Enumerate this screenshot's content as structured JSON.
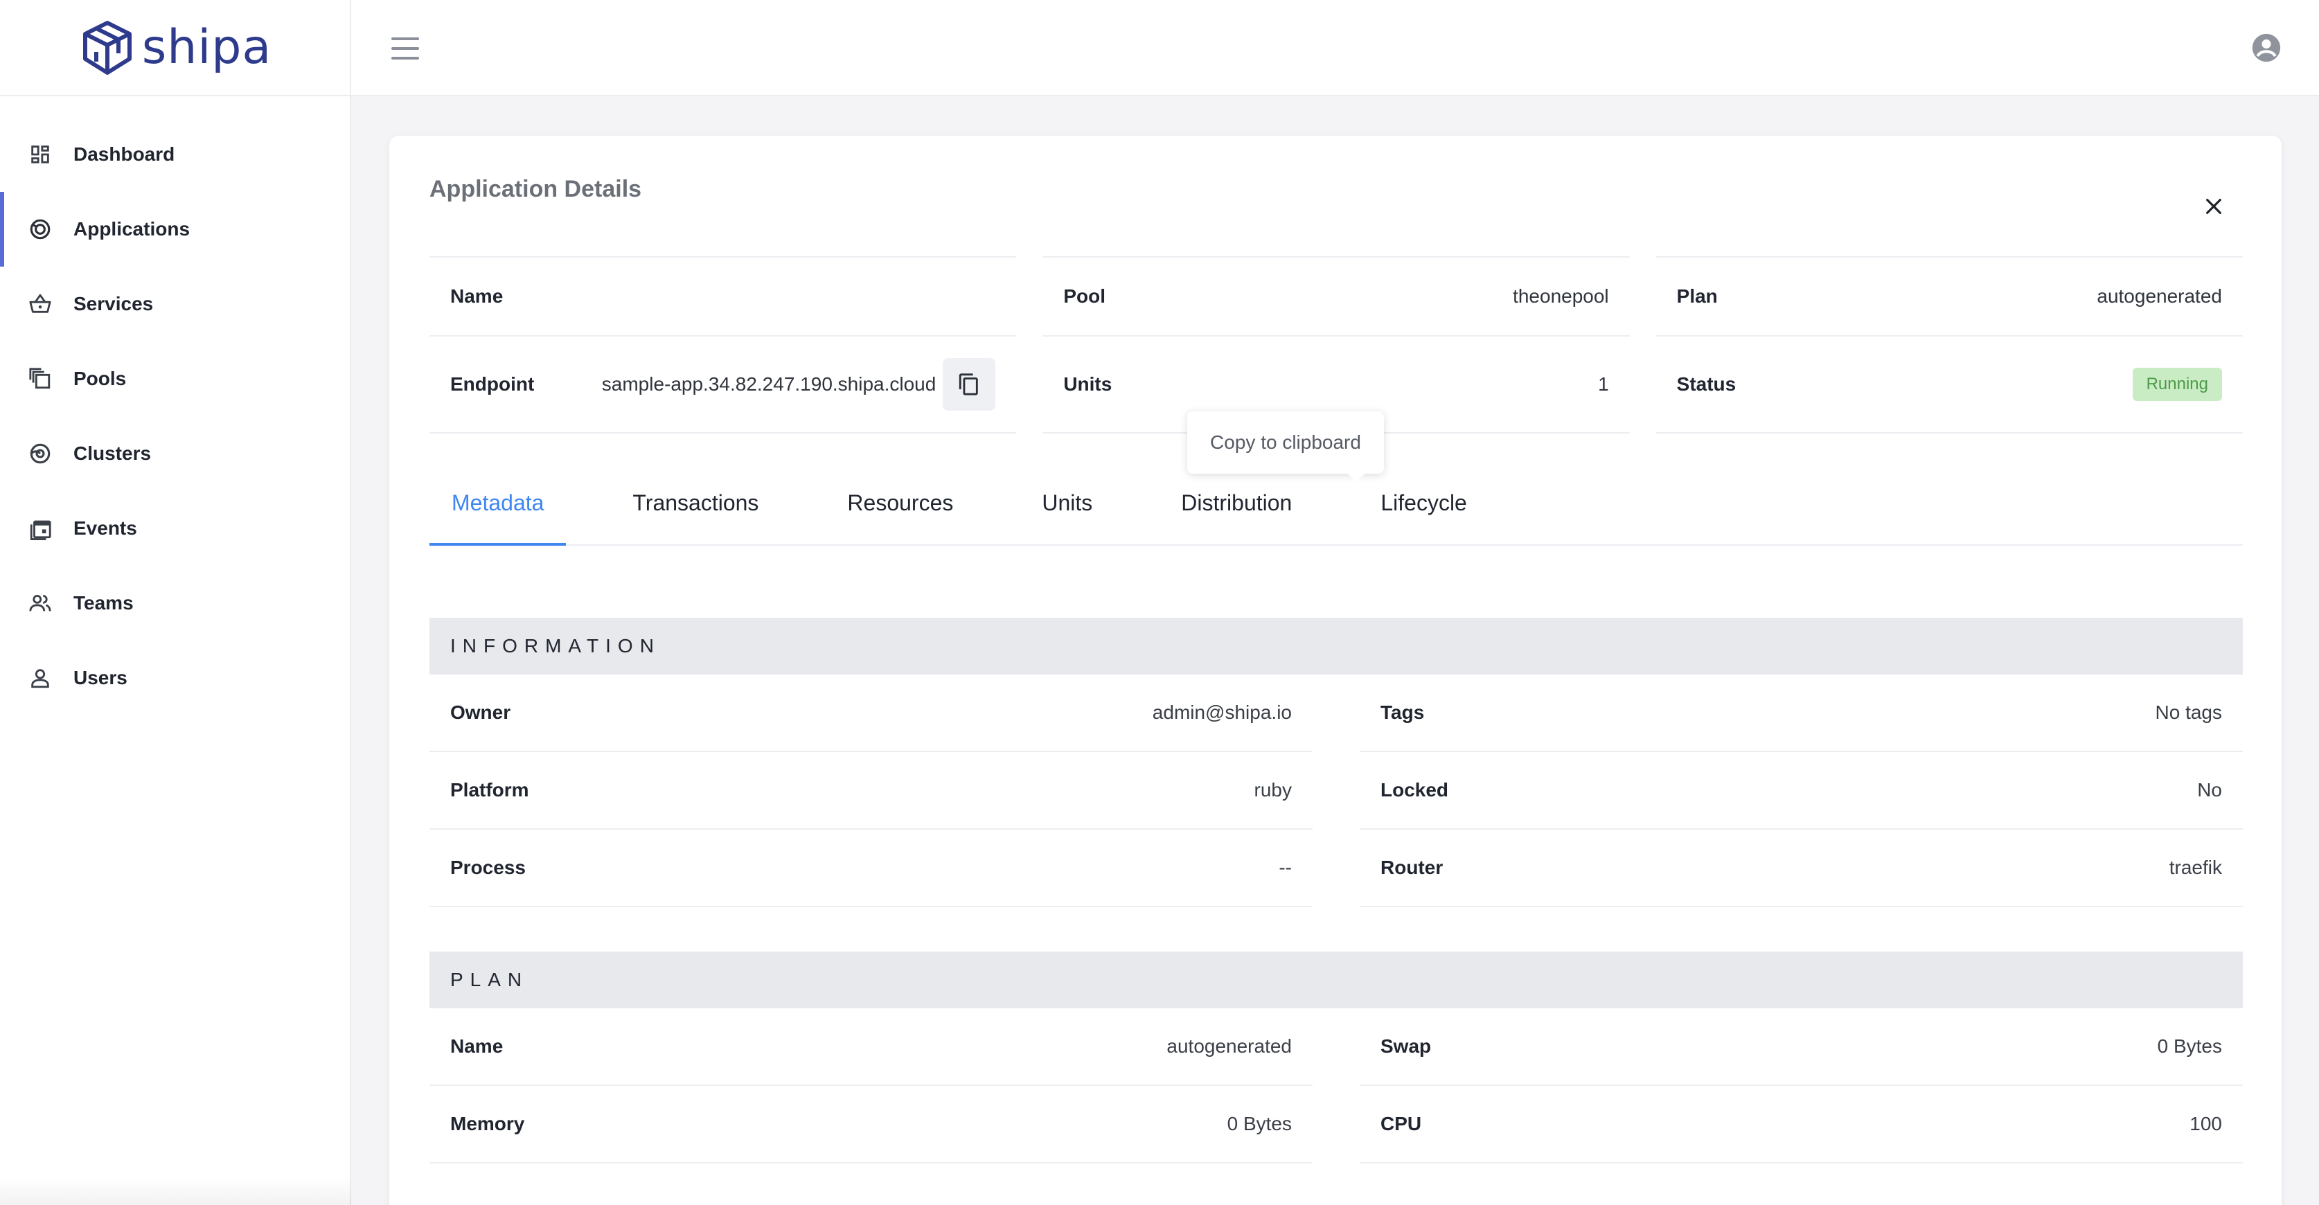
{
  "brand": {
    "name": "shipa",
    "color": "#2e3a8c"
  },
  "sidebar": {
    "items": [
      {
        "label": "Dashboard",
        "icon": "dashboard-icon"
      },
      {
        "label": "Applications",
        "icon": "applications-icon",
        "active": true
      },
      {
        "label": "Services",
        "icon": "basket-icon"
      },
      {
        "label": "Pools",
        "icon": "pools-icon"
      },
      {
        "label": "Clusters",
        "icon": "clusters-icon"
      },
      {
        "label": "Events",
        "icon": "calendar-icon"
      },
      {
        "label": "Teams",
        "icon": "team-icon"
      },
      {
        "label": "Users",
        "icon": "user-icon"
      }
    ]
  },
  "header": {
    "menu_icon": "hamburger-icon",
    "account_icon": "account-circle-icon"
  },
  "details": {
    "title": "Application Details",
    "name_label": "Name",
    "endpoint_label": "Endpoint",
    "endpoint_value": "sample-app.34.82.247.190.shipa.cloud",
    "pool_label": "Pool",
    "pool_value": "theonepool",
    "units_label": "Units",
    "units_value": "1",
    "plan_label": "Plan",
    "plan_value": "autogenerated",
    "status_label": "Status",
    "status_value": "Running",
    "status_color": "#c9ecc5"
  },
  "tooltip": {
    "text": "Copy to clipboard"
  },
  "tabs": [
    "Metadata",
    "Transactions",
    "Resources",
    "Units",
    "Distribution",
    "Lifecycle"
  ],
  "active_tab": "Metadata",
  "accent_color": "#3f86f0",
  "information": {
    "heading": "INFORMATION",
    "rows_left": [
      {
        "label": "Owner",
        "value": "admin@shipa.io"
      },
      {
        "label": "Platform",
        "value": "ruby"
      },
      {
        "label": "Process",
        "value": "--"
      }
    ],
    "rows_right": [
      {
        "label": "Tags",
        "value": "No tags"
      },
      {
        "label": "Locked",
        "value": "No"
      },
      {
        "label": "Router",
        "value": "traefik"
      }
    ]
  },
  "plan": {
    "heading": "PLAN",
    "rows_left": [
      {
        "label": "Name",
        "value": "autogenerated"
      },
      {
        "label": "Memory",
        "value": "0 Bytes"
      }
    ],
    "rows_right": [
      {
        "label": "Swap",
        "value": "0 Bytes"
      },
      {
        "label": "CPU",
        "value": "100"
      }
    ]
  }
}
